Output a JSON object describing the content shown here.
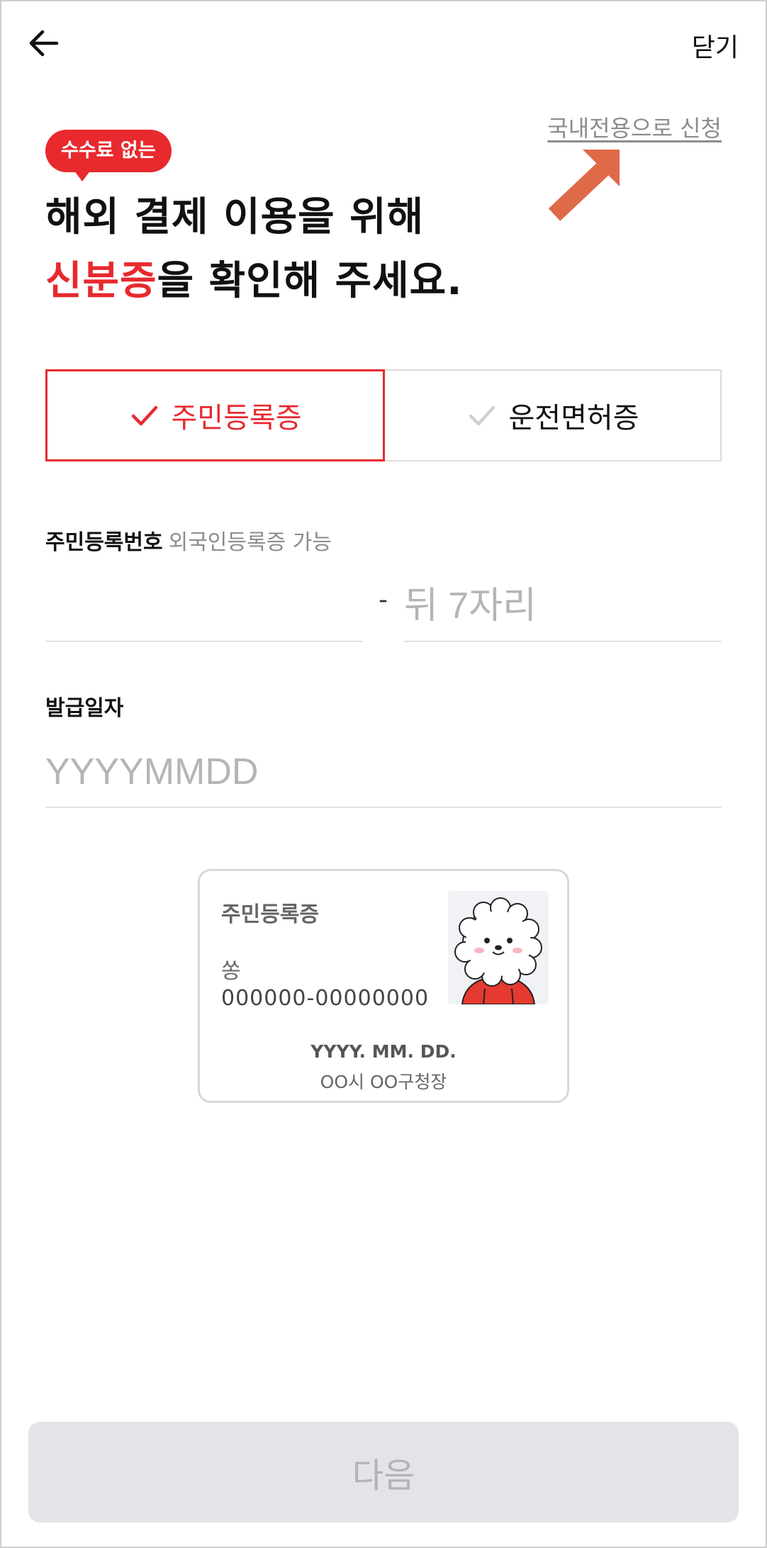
{
  "header": {
    "back_icon": "arrow-left-icon",
    "close_label": "닫기"
  },
  "domestic_link": "국내전용으로 신청",
  "badge": "수수료 없는",
  "headline": {
    "line1": "해외 결제 이용을 위해",
    "line2_highlight": "신분증",
    "line2_rest": "을 확인해 주세요."
  },
  "id_type": {
    "options": [
      {
        "label": "주민등록증",
        "selected": true
      },
      {
        "label": "운전면허증",
        "selected": false
      }
    ],
    "check_icon": "checkmark-icon"
  },
  "resident_number": {
    "label": "주민등록번호",
    "sublabel": "외국인등록증 가능",
    "front_value": "",
    "front_placeholder": "",
    "separator": "-",
    "back_placeholder": "뒤 7자리"
  },
  "issue_date": {
    "label": "발급일자",
    "placeholder": "YYYYMMDD"
  },
  "sample_card": {
    "title": "주민등록증",
    "name": "쏭",
    "number": "000000-00000000",
    "date": "YYYY. MM. DD.",
    "issuer": "OO시 OO구청장",
    "photo": "character-illustration"
  },
  "next_button": "다음",
  "colors": {
    "accent": "#e8292e",
    "annotation_arrow": "#de6a48",
    "disabled_bg": "#e3e4e8",
    "disabled_text": "#b2b3b8"
  }
}
